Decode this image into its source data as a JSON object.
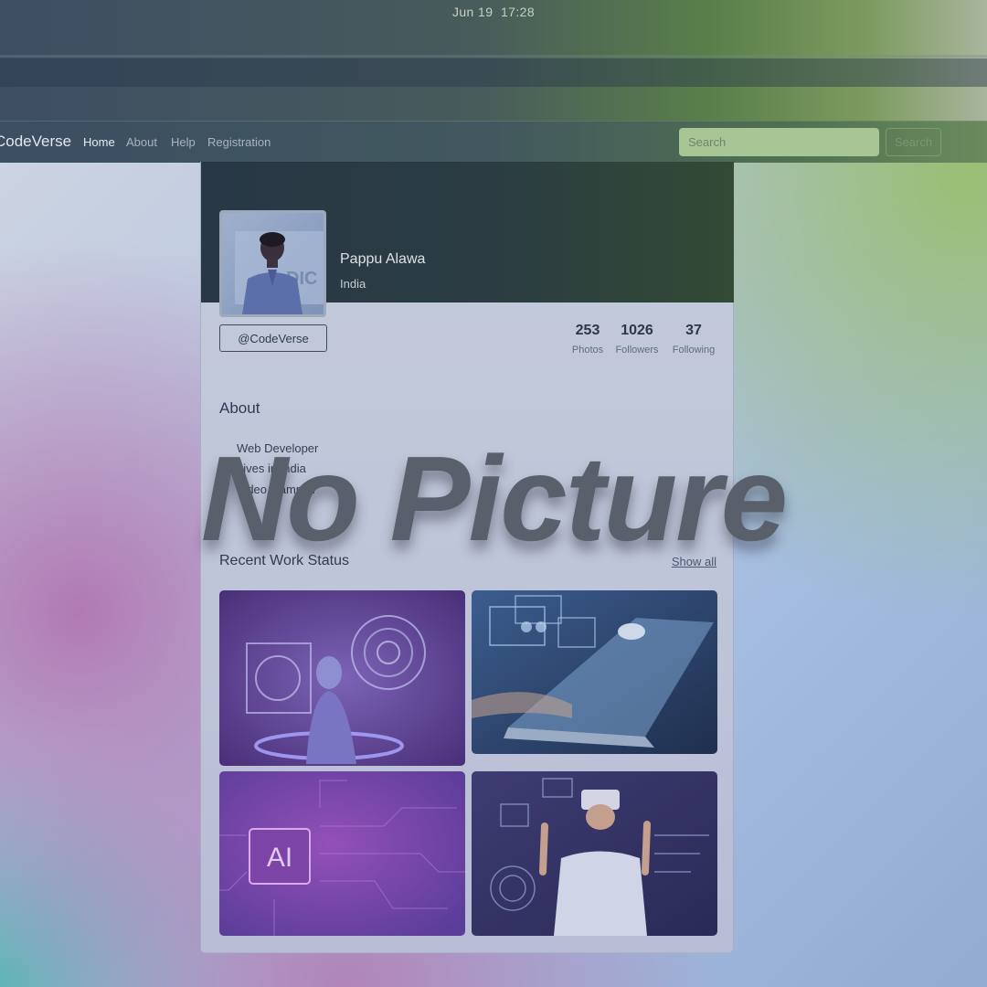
{
  "system_bar": {
    "date": "Jun 19",
    "time": "17:28"
  },
  "navbar": {
    "brand": "CodeVerse",
    "links": [
      "Home",
      "About",
      "Help",
      "Registration"
    ],
    "search_placeholder": "Search",
    "search_button": "Search"
  },
  "profile": {
    "name": "Pappu Alawa",
    "location": "India",
    "handle_button": "@CodeVerse",
    "stats": [
      {
        "value": "253",
        "label": "Photos"
      },
      {
        "value": "1026",
        "label": "Followers"
      },
      {
        "value": "37",
        "label": "Following"
      }
    ]
  },
  "about": {
    "title": "About",
    "items": [
      "Web Developer",
      "Lives in India",
      "Video Gammer"
    ]
  },
  "recent": {
    "title": "Recent Work Status",
    "show_all": "Show all",
    "images": [
      {
        "icon": "robot-hologram-image"
      },
      {
        "icon": "laptop-robot-hand-image"
      },
      {
        "icon": "ai-chip-image",
        "caption": "AI"
      },
      {
        "icon": "vr-headset-person-image"
      }
    ]
  },
  "overlay_text": "No Picture",
  "avatar_text": "DIC"
}
